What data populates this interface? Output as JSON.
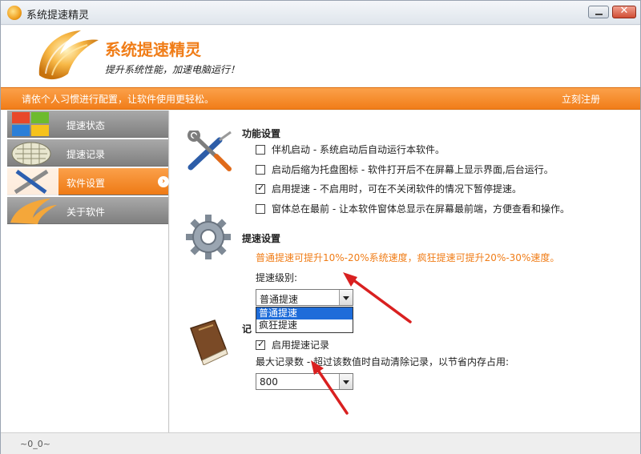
{
  "window": {
    "title": "系统提速精灵"
  },
  "header": {
    "app_name": "系统提速精灵",
    "slogan": "提升系统性能，加速电脑运行！"
  },
  "banner": {
    "text": "请依个人习惯进行配置，让软件使用更轻松。",
    "register_label": "立刻注册"
  },
  "sidebar": {
    "items": [
      {
        "label": "提速状态",
        "active": false
      },
      {
        "label": "提速记录",
        "active": false
      },
      {
        "label": "软件设置",
        "active": true
      },
      {
        "label": "关于软件",
        "active": false
      }
    ]
  },
  "function_settings": {
    "title": "功能设置",
    "options": [
      {
        "label": "伴机启动 - 系统启动后自动运行本软件。",
        "checked": false
      },
      {
        "label": "启动后缩为托盘图标 - 软件打开后不在屏幕上显示界面,后台运行。",
        "checked": false
      },
      {
        "label": "启用提速 - 不启用时，可在不关闭软件的情况下暂停提速。",
        "checked": true
      },
      {
        "label": "窗体总在最前 - 让本软件窗体总显示在屏幕最前端，方便查看和操作。",
        "checked": false
      }
    ]
  },
  "speed_settings": {
    "title": "提速设置",
    "note": "普通提速可提升10%-20%系统速度，疯狂提速可提升20%-30%速度。",
    "level_label": "提速级别:",
    "level_value": "普通提速",
    "level_options": [
      "普通提速",
      "疯狂提速"
    ]
  },
  "record_settings": {
    "title_visible": "记",
    "enable_label": "启用提速记录",
    "enable_checked": true,
    "max_label": "最大记录数 - 超过该数值时自动清除记录，以节省内存占用:",
    "max_value": "800"
  },
  "statusbar": {
    "text": "~0_0~"
  },
  "colors": {
    "accent": "#f07d18",
    "annotation_arrow": "#d92020",
    "selection": "#1e6cd9"
  }
}
